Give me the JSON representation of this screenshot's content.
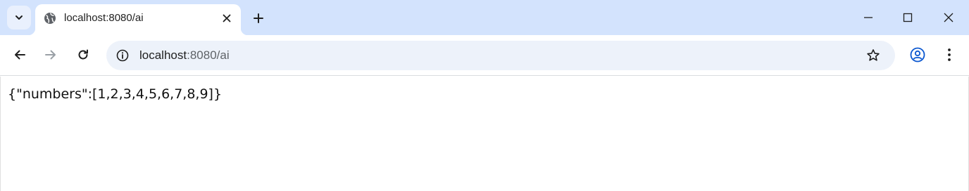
{
  "browser": {
    "tabs": [
      {
        "title": "localhost:8080/ai",
        "active": true
      }
    ],
    "address_bar": {
      "host": "localhost",
      "rest": ":8080/ai"
    },
    "accent_color": "#d3e3fd",
    "icons": [
      "chevron-down-icon",
      "globe-icon",
      "close-icon",
      "plus-icon",
      "minimize-icon",
      "maximize-icon",
      "window-close-icon",
      "back-arrow-icon",
      "forward-arrow-icon",
      "reload-icon",
      "info-icon",
      "star-icon",
      "profile-icon",
      "kebab-menu-icon"
    ]
  },
  "page": {
    "body_text": "{\"numbers\":[1,2,3,4,5,6,7,8,9]}"
  }
}
